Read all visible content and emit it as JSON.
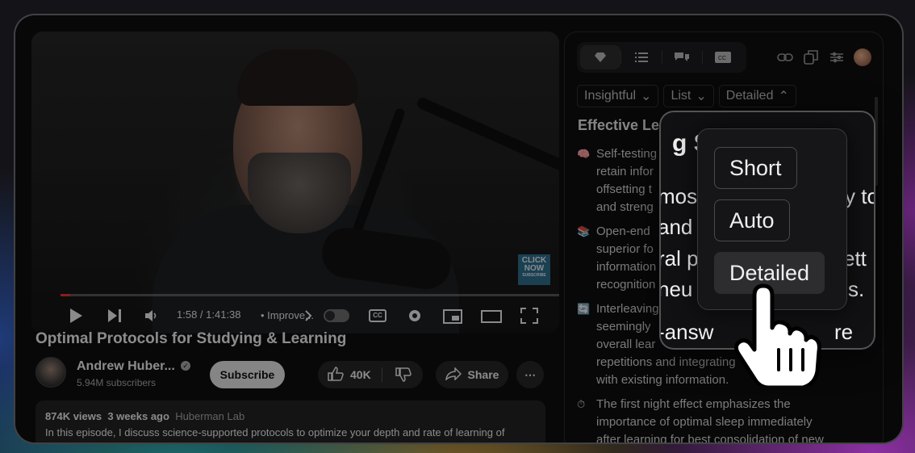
{
  "video": {
    "time": "1:58 / 1:41:38",
    "chapter": "• Improve...",
    "progress_fraction": 0.019,
    "thumbnail_badge": {
      "line1": "CLICK",
      "line2": "NOW",
      "line3": "SUBSCRIBE"
    }
  },
  "title": "Optimal Protocols for Studying & Learning",
  "channel": {
    "name": "Andrew Huber...",
    "subscribers": "5.94M subscribers",
    "subscribe_label": "Subscribe"
  },
  "actions": {
    "likes": "40K",
    "share": "Share"
  },
  "description": {
    "views": "874K views",
    "age": "3 weeks ago",
    "channel": "Huberman Lab",
    "text": "In this episode, I discuss science-supported protocols to optimize your depth and rate of learning of"
  },
  "panel": {
    "tabs": [
      "diamond-icon",
      "list-icon",
      "chat-icon",
      "cc-icon"
    ],
    "filters": [
      "Insightful",
      "List",
      "Detailed"
    ],
    "section_title": "Effective Le",
    "bullets": [
      {
        "emoji": "🧠",
        "lines": [
          "Self-testing",
          "retain infor",
          "offsetting t",
          "and streng"
        ]
      },
      {
        "emoji": "📚",
        "lines": [
          "Open-end",
          "superior fo",
          "information",
          "recognition"
        ]
      },
      {
        "emoji": "🔄",
        "lines": [
          "Interleaving",
          "seemingly",
          "overall lear",
          "repetitions and integrating",
          "with existing information."
        ]
      },
      {
        "emoji": "⏱",
        "lines": [
          "The first night effect emphasizes the",
          "importance of optimal sleep immediately",
          "after learning for best consolidation of new"
        ]
      }
    ],
    "bullet3_tail": "edge"
  },
  "zoom": {
    "heading": "g St",
    "lines": [
      "mos",
      "y to",
      "and",
      "ral p",
      "ett",
      "neu",
      "s.",
      "-answ",
      "re"
    ],
    "options": [
      "Short",
      "Auto",
      "Detailed"
    ],
    "selected": "Detailed"
  },
  "colors": {
    "accent_red": "#e33333",
    "panel_bg": "#0f0f11"
  }
}
